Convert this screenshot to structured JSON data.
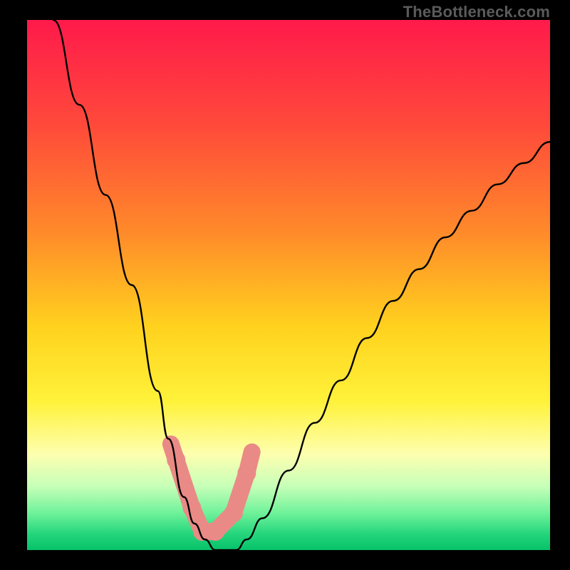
{
  "watermark": "TheBottleneck.com",
  "chart_data": {
    "type": "line",
    "title": "",
    "xlabel": "",
    "ylabel": "",
    "xlim": [
      0,
      100
    ],
    "ylim": [
      0,
      100
    ],
    "x": [
      5,
      10,
      15,
      20,
      25,
      27,
      30,
      32,
      34,
      36,
      38,
      40,
      42,
      45,
      50,
      55,
      60,
      65,
      70,
      75,
      80,
      85,
      90,
      95,
      100
    ],
    "values": [
      100,
      84,
      67,
      50,
      30,
      21,
      10,
      5,
      2,
      0,
      0,
      0,
      2,
      6,
      15,
      24,
      32,
      40,
      47,
      53,
      59,
      64,
      69,
      73,
      77
    ],
    "background_gradient_stops": [
      {
        "offset": 0.0,
        "color": "#ff1a4b"
      },
      {
        "offset": 0.2,
        "color": "#ff4a3a"
      },
      {
        "offset": 0.4,
        "color": "#ff8a2a"
      },
      {
        "offset": 0.58,
        "color": "#ffd21e"
      },
      {
        "offset": 0.72,
        "color": "#fff23a"
      },
      {
        "offset": 0.82,
        "color": "#fdffb0"
      },
      {
        "offset": 0.88,
        "color": "#c6ffb8"
      },
      {
        "offset": 0.93,
        "color": "#6ff29a"
      },
      {
        "offset": 0.97,
        "color": "#24d57c"
      },
      {
        "offset": 1.0,
        "color": "#07c26a"
      }
    ],
    "marker_band": {
      "y_min_pct": 0.78,
      "y_max_pct": 0.98,
      "color": "#e98a86",
      "points_norm_x": [
        0.275,
        0.285,
        0.315,
        0.335,
        0.36,
        0.395,
        0.42,
        0.43
      ],
      "points_norm_y": [
        0.8,
        0.83,
        0.92,
        0.965,
        0.965,
        0.93,
        0.855,
        0.815
      ]
    }
  }
}
